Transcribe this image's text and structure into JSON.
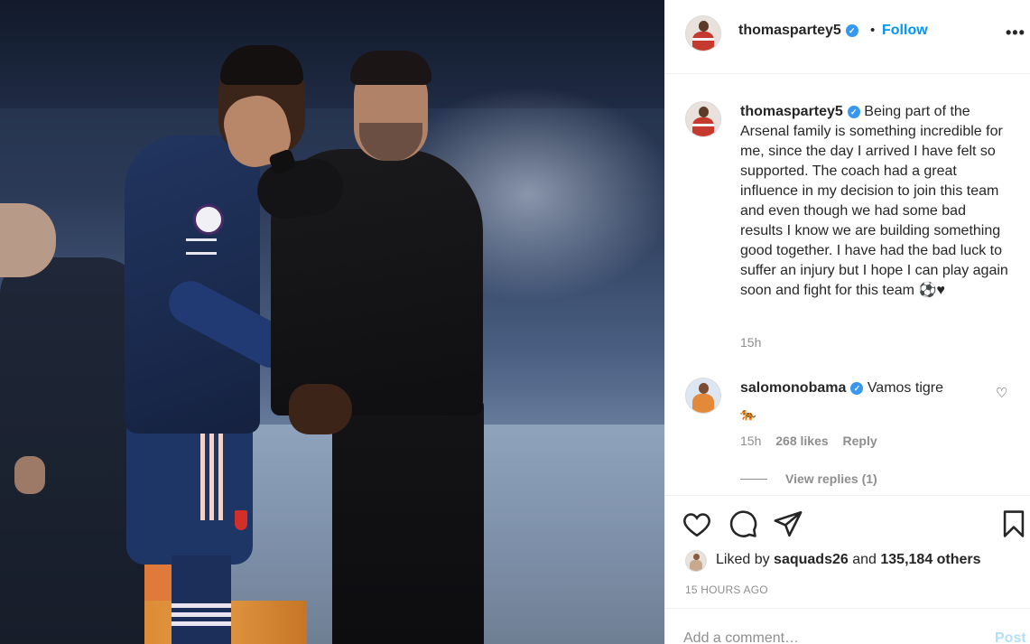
{
  "post": {
    "image_alt": "Photo by thomaspartey5",
    "header": {
      "username": "thomaspartey5",
      "separator": "•",
      "follow_label": "Follow",
      "more_icon": "more-horizontal-icon",
      "more_label": "•••"
    },
    "caption": {
      "username": "thomaspartey5",
      "text": "Being part of the Arsenal family is something incredible for me, since the day I arrived I have felt so supported. The coach had a great influence in my decision to join this team and even though we had some bad results I know we are building something good together. I have had the bad luck to suffer an injury but I hope I can play again soon and fight for this team ⚽♥",
      "time": "15h"
    },
    "comments": [
      {
        "username": "salomonobama",
        "text": "Vamos tigre",
        "emoji": "🐅",
        "time": "15h",
        "likes": "268 likes",
        "reply_label": "Reply",
        "view_replies": "View replies (1)"
      }
    ],
    "likes": {
      "prefix": "Liked by",
      "first_user": "saquads26",
      "conjunction": "and",
      "others": "135,184 others"
    },
    "timestamp": "15 HOURS AGO",
    "add_comment": {
      "placeholder": "Add a comment…",
      "post_label": "Post"
    },
    "colors": {
      "link_blue": "#0095f6",
      "verified_blue": "#3897f0",
      "post_disabled": "#b2dffc",
      "secondary_text": "#8e8e8e"
    },
    "icons": [
      "heart-icon",
      "comment-icon",
      "share-icon",
      "bookmark-icon",
      "verified-badge-icon"
    ]
  }
}
